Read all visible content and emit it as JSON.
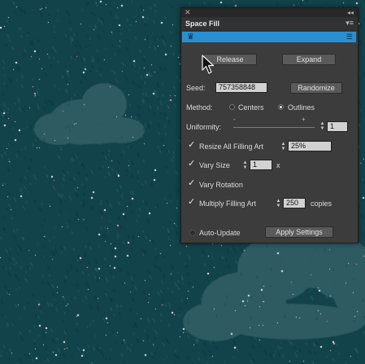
{
  "panel": {
    "title": "Space Fill",
    "buttons": {
      "release": "Release",
      "expand": "Expand",
      "randomize": "Randomize",
      "apply": "Apply Settings"
    },
    "seed": {
      "label": "Seed:",
      "value": "757358848"
    },
    "method": {
      "label": "Method:",
      "options": [
        "Centers",
        "Outlines"
      ],
      "selected": "Outlines"
    },
    "uniformity": {
      "label": "Uniformity:",
      "min_symbol": "-",
      "max_symbol": "+",
      "value": "1"
    },
    "resize": {
      "label": "Resize All Filling Art",
      "checked": true,
      "value": "25%"
    },
    "vary_size": {
      "label": "Vary Size",
      "checked": true,
      "value": "1",
      "suffix": "x"
    },
    "vary_rotation": {
      "label": "Vary Rotation",
      "checked": true
    },
    "multiply": {
      "label": "Multiply Filling Art",
      "checked": true,
      "value": "250",
      "suffix": "copies"
    },
    "auto_update": {
      "label": "Auto-Update",
      "checked": false
    },
    "icons": [
      "close-icon",
      "collapse-icon",
      "panel-menu-icon",
      "crown-icon",
      "grip-icon"
    ]
  },
  "colors": {
    "background": "#12424a",
    "cloud": "#2e5a62",
    "panel": "#3c3c3c",
    "accent": "#2a8fd0"
  }
}
